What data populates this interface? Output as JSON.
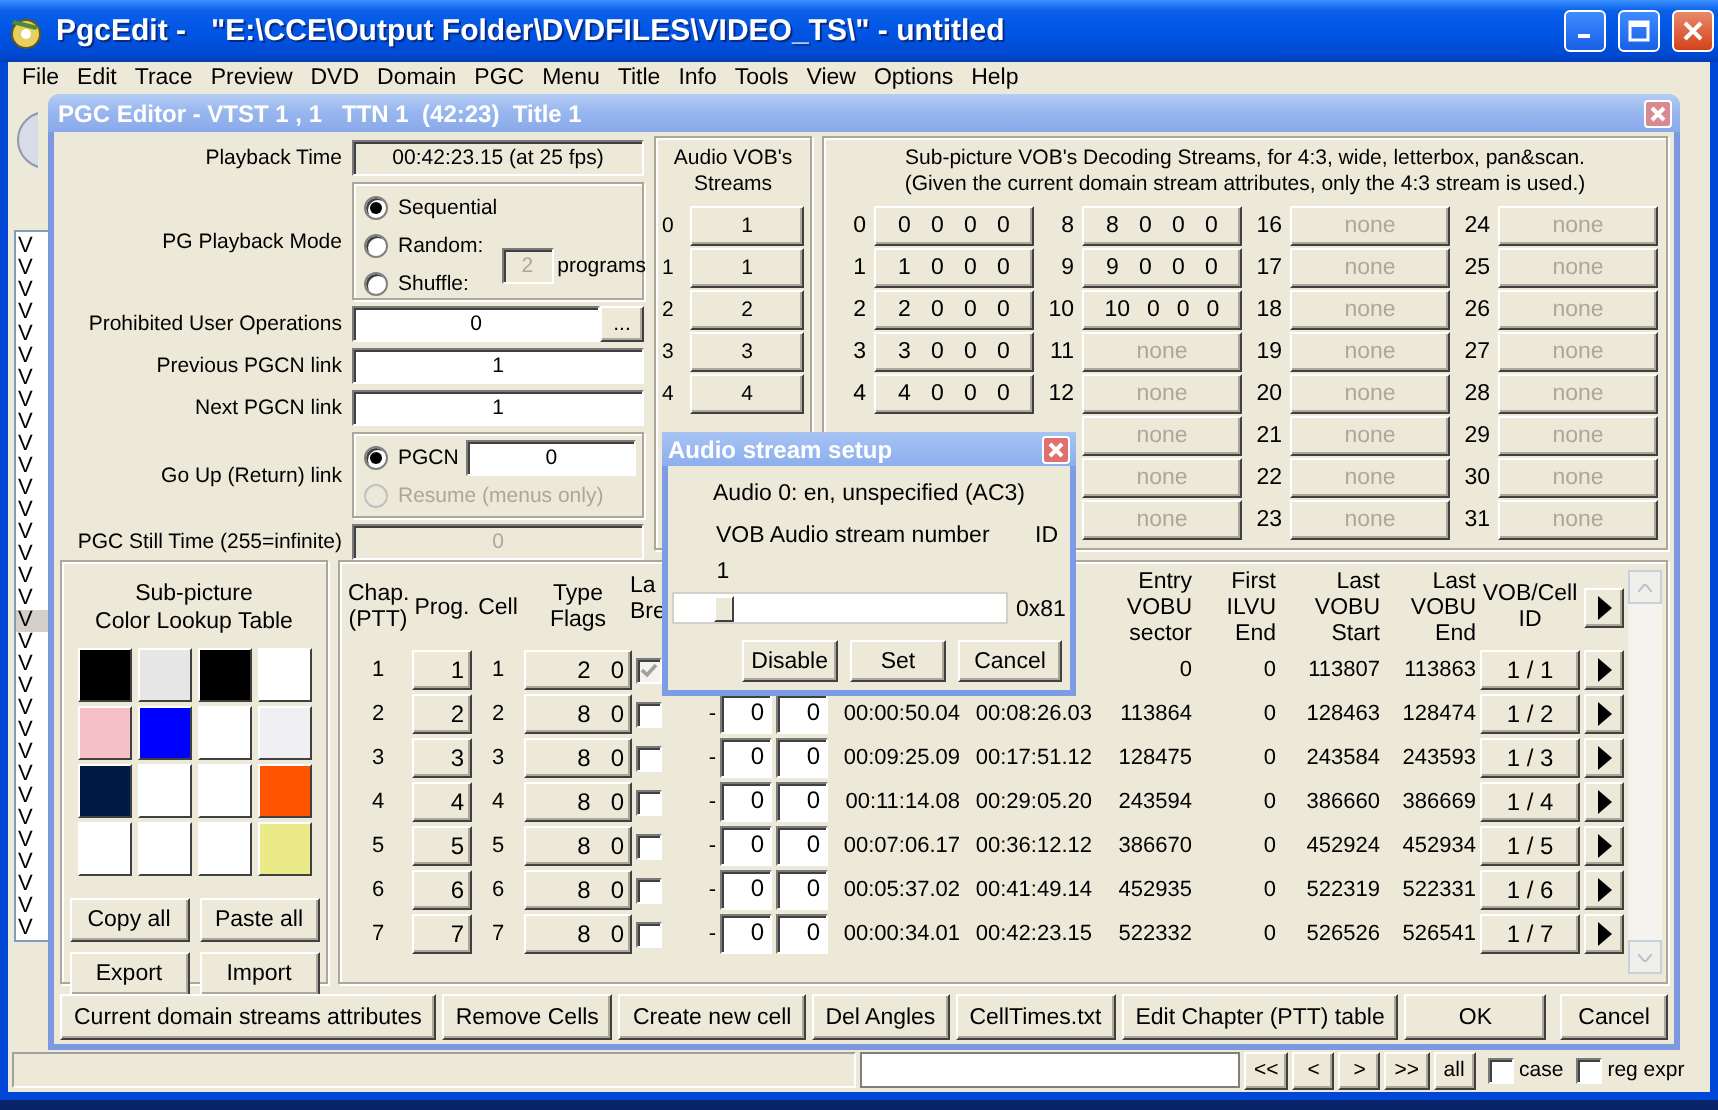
{
  "app": {
    "title": "PgcEdit -   \"E:\\CCE\\Output Folder\\DVDFILES\\VIDEO_TS\\\" - untitled"
  },
  "menu": [
    "File",
    "Edit",
    "Trace",
    "Preview",
    "DVD",
    "Domain",
    "PGC",
    "Menu",
    "Title",
    "Info",
    "Tools",
    "View",
    "Options",
    "Help"
  ],
  "pgc_list": [
    {
      "label": "V",
      "selected": false
    },
    {
      "label": "V",
      "selected": false
    },
    {
      "label": "V",
      "selected": false
    },
    {
      "label": "V",
      "selected": false
    },
    {
      "label": "V",
      "selected": false
    },
    {
      "label": "V",
      "selected": false
    },
    {
      "label": "V",
      "selected": false
    },
    {
      "label": "V",
      "selected": false
    },
    {
      "label": "V",
      "selected": false
    },
    {
      "label": "V",
      "selected": false
    },
    {
      "label": "V",
      "selected": false
    },
    {
      "label": "V",
      "selected": false
    },
    {
      "label": "V",
      "selected": false
    },
    {
      "label": "V",
      "selected": false
    },
    {
      "label": "V",
      "selected": false
    },
    {
      "label": "V",
      "selected": false
    },
    {
      "label": "V",
      "selected": false
    },
    {
      "label": "V",
      "selected": true
    },
    {
      "label": "V",
      "selected": false
    },
    {
      "label": "V",
      "selected": false
    },
    {
      "label": "V",
      "selected": false
    },
    {
      "label": "V",
      "selected": false
    },
    {
      "label": "V",
      "selected": false
    },
    {
      "label": "V",
      "selected": false
    },
    {
      "label": "V",
      "selected": false
    },
    {
      "label": "V",
      "selected": false
    },
    {
      "label": "V",
      "selected": false
    },
    {
      "label": "V",
      "selected": false
    },
    {
      "label": "V",
      "selected": false
    },
    {
      "label": "V",
      "selected": false
    },
    {
      "label": "V",
      "selected": false
    },
    {
      "label": "V",
      "selected": false
    }
  ],
  "editor": {
    "title": "PGC Editor - VTST 1 , 1   TTN 1  (42:23)  Title 1",
    "playback_time": {
      "label": "Playback Time",
      "value": "00:42:23.15 (at 25 fps)"
    },
    "playback_mode": {
      "label": "PG Playback Mode",
      "options": [
        {
          "label": "Sequential",
          "selected": true
        },
        {
          "label": "Random:",
          "selected": false
        },
        {
          "label": "Shuffle:",
          "selected": false
        }
      ],
      "programs": {
        "value": "2",
        "label": "programs",
        "disabled": true
      }
    },
    "prohibited_ops": {
      "label": "Prohibited User Operations",
      "value": "0",
      "button": "..."
    },
    "previous_pgcn": {
      "label": "Previous PGCN link",
      "value": "1"
    },
    "next_pgcn": {
      "label": "Next PGCN link",
      "value": "1"
    },
    "go_up": {
      "label": "Go Up (Return) link",
      "options": [
        {
          "label": "PGCN",
          "selected": true,
          "disabled": false,
          "value": "0"
        },
        {
          "label": "Resume (menus only)",
          "selected": false,
          "disabled": true
        }
      ]
    },
    "still_time": {
      "label": "PGC Still Time (255=infinite)",
      "value": "0",
      "disabled": true
    },
    "audio_streams": {
      "title": "Audio VOB's Streams",
      "items": [
        {
          "label": "0",
          "value": "1"
        },
        {
          "label": "1",
          "value": "1"
        },
        {
          "label": "2",
          "value": "2"
        },
        {
          "label": "3",
          "value": "3"
        },
        {
          "label": "4",
          "value": "4"
        }
      ]
    },
    "subpicture_streams": {
      "title": "Sub-picture VOB's Decoding Streams, for 4:3, wide, letterbox, pan&scan.",
      "note": "(Given the current domain stream attributes, only the 4:3 stream is used.)",
      "columns": [
        [
          {
            "label": "0",
            "values": [
              "0",
              "0",
              "0",
              "0"
            ],
            "disabled": false
          },
          {
            "label": "1",
            "values": [
              "1",
              "0",
              "0",
              "0"
            ],
            "disabled": false
          },
          {
            "label": "2",
            "values": [
              "2",
              "0",
              "0",
              "0"
            ],
            "disabled": false
          },
          {
            "label": "3",
            "values": [
              "3",
              "0",
              "0",
              "0"
            ],
            "disabled": false
          },
          {
            "label": "4",
            "values": [
              "4",
              "0",
              "0",
              "0"
            ],
            "disabled": false
          }
        ],
        [
          {
            "label": "8",
            "values": [
              "8",
              "0",
              "0",
              "0"
            ],
            "disabled": false
          },
          {
            "label": "9",
            "values": [
              "9",
              "0",
              "0",
              "0"
            ],
            "disabled": false
          },
          {
            "label": "10",
            "values": [
              "10",
              "0",
              "0",
              "0"
            ],
            "disabled": false
          },
          {
            "label": "11",
            "values": [
              "none"
            ],
            "disabled": true
          },
          {
            "label": "12",
            "values": [
              "none"
            ],
            "disabled": true
          },
          {
            "values": [
              "none"
            ],
            "disabled": true
          },
          {
            "values": [
              "none"
            ],
            "disabled": true
          },
          {
            "values": [
              "none"
            ],
            "disabled": true
          }
        ],
        [
          {
            "label": "16",
            "values": [
              "none"
            ],
            "disabled": true
          },
          {
            "label": "17",
            "values": [
              "none"
            ],
            "disabled": true
          },
          {
            "label": "18",
            "values": [
              "none"
            ],
            "disabled": true
          },
          {
            "label": "19",
            "values": [
              "none"
            ],
            "disabled": true
          },
          {
            "label": "20",
            "values": [
              "none"
            ],
            "disabled": true
          },
          {
            "label": "21",
            "values": [
              "none"
            ],
            "disabled": true
          },
          {
            "label": "22",
            "values": [
              "none"
            ],
            "disabled": true
          },
          {
            "label": "23",
            "values": [
              "none"
            ],
            "disabled": true
          }
        ],
        [
          {
            "label": "24",
            "values": [
              "none"
            ],
            "disabled": true
          },
          {
            "label": "25",
            "values": [
              "none"
            ],
            "disabled": true
          },
          {
            "label": "26",
            "values": [
              "none"
            ],
            "disabled": true
          },
          {
            "label": "27",
            "values": [
              "none"
            ],
            "disabled": true
          },
          {
            "label": "28",
            "values": [
              "none"
            ],
            "disabled": true
          },
          {
            "label": "29",
            "values": [
              "none"
            ],
            "disabled": true
          },
          {
            "label": "30",
            "values": [
              "none"
            ],
            "disabled": true
          },
          {
            "label": "31",
            "values": [
              "none"
            ],
            "disabled": true
          }
        ]
      ]
    },
    "color_table": {
      "title_lines": [
        "Sub-picture",
        "Color Lookup Table"
      ],
      "colors": [
        {
          "color": "#000000"
        },
        {
          "color": "#e6e6e6"
        },
        {
          "color": "#000000"
        },
        {
          "color": "#ffffff"
        },
        {
          "color": "#f6c0c6"
        },
        {
          "color": "#0000ff"
        },
        {
          "color": "#ffffff"
        },
        {
          "color": "#f0f0f2"
        },
        {
          "color": "#001a48"
        },
        {
          "color": "#ffffff"
        },
        {
          "color": "#ffffff"
        },
        {
          "color": "#ff5500"
        },
        {
          "color": "#ffffff"
        },
        {
          "color": "#ffffff"
        },
        {
          "color": "#ffffff"
        },
        {
          "color": "#eaea88"
        }
      ],
      "buttons": [
        "Copy all",
        "Paste all",
        "Export",
        "Import"
      ]
    },
    "cells": {
      "headers": [
        "Chap.\n(PTT)",
        "Prog.",
        "Cell",
        "Type\nFlags",
        "La\nBre",
        "Entry\nVOBU\nsector",
        "First\nILVU\nEnd",
        "Last\nVOBU\nStart",
        "Last\nVOBU\nEnd",
        "VOB/Cell\nID"
      ],
      "rows": [
        {
          "chapter": "1",
          "program": "1",
          "cell": "1",
          "flags": [
            "2",
            "0"
          ],
          "layer_break": true,
          "entry_sector": "0",
          "first_ilvu_end": "0",
          "last_vobu_start": "113807",
          "last_vobu_end": "113863",
          "vob_cell_id": "1 / 1"
        },
        {
          "chapter": "2",
          "program": "2",
          "cell": "2",
          "flags": [
            "8",
            "0"
          ],
          "layer_break": false,
          "dash": "-",
          "angles": [
            "0",
            "0"
          ],
          "start": "00:00:50.04",
          "end": "00:08:26.03",
          "entry_sector": "113864",
          "first_ilvu_end": "0",
          "last_vobu_start": "128463",
          "last_vobu_end": "128474",
          "vob_cell_id": "1 / 2"
        },
        {
          "chapter": "3",
          "program": "3",
          "cell": "3",
          "flags": [
            "8",
            "0"
          ],
          "layer_break": false,
          "dash": "-",
          "angles": [
            "0",
            "0"
          ],
          "start": "00:09:25.09",
          "end": "00:17:51.12",
          "entry_sector": "128475",
          "first_ilvu_end": "0",
          "last_vobu_start": "243584",
          "last_vobu_end": "243593",
          "vob_cell_id": "1 / 3"
        },
        {
          "chapter": "4",
          "program": "4",
          "cell": "4",
          "flags": [
            "8",
            "0"
          ],
          "layer_break": false,
          "dash": "-",
          "angles": [
            "0",
            "0"
          ],
          "start": "00:11:14.08",
          "end": "00:29:05.20",
          "entry_sector": "243594",
          "first_ilvu_end": "0",
          "last_vobu_start": "386660",
          "last_vobu_end": "386669",
          "vob_cell_id": "1 / 4"
        },
        {
          "chapter": "5",
          "program": "5",
          "cell": "5",
          "flags": [
            "8",
            "0"
          ],
          "layer_break": false,
          "dash": "-",
          "angles": [
            "0",
            "0"
          ],
          "start": "00:07:06.17",
          "end": "00:36:12.12",
          "entry_sector": "386670",
          "first_ilvu_end": "0",
          "last_vobu_start": "452924",
          "last_vobu_end": "452934",
          "vob_cell_id": "1 / 5"
        },
        {
          "chapter": "6",
          "program": "6",
          "cell": "6",
          "flags": [
            "8",
            "0"
          ],
          "layer_break": false,
          "dash": "-",
          "angles": [
            "0",
            "0"
          ],
          "start": "00:05:37.02",
          "end": "00:41:49.14",
          "entry_sector": "452935",
          "first_ilvu_end": "0",
          "last_vobu_start": "522319",
          "last_vobu_end": "522331",
          "vob_cell_id": "1 / 6"
        },
        {
          "chapter": "7",
          "program": "7",
          "cell": "7",
          "flags": [
            "8",
            "0"
          ],
          "layer_break": false,
          "dash": "-",
          "angles": [
            "0",
            "0"
          ],
          "start": "00:00:34.01",
          "end": "00:42:23.15",
          "entry_sector": "522332",
          "first_ilvu_end": "0",
          "last_vobu_start": "526526",
          "last_vobu_end": "526541",
          "vob_cell_id": "1 / 7"
        }
      ]
    },
    "buttons": [
      "Current domain streams attributes",
      "Remove Cells",
      "Create new cell",
      "Del Angles",
      "CellTimes.txt",
      "Edit Chapter (PTT) table"
    ],
    "ok": "OK",
    "cancel": "Cancel"
  },
  "dialog": {
    "title": "Audio stream setup",
    "info": "Audio 0: en, unspecified (AC3)",
    "number_label": "VOB Audio stream number",
    "id_label": "ID",
    "slider": {
      "value": "1",
      "level": 0.15
    },
    "id_value": "0x81",
    "buttons": [
      "Disable",
      "Set",
      "Cancel"
    ]
  },
  "status_bar": {
    "nav_buttons": [
      "<<",
      "<",
      ">",
      ">>",
      "all"
    ],
    "options": [
      {
        "label": "case",
        "checked": false
      },
      {
        "label": "reg expr",
        "checked": false
      }
    ]
  }
}
